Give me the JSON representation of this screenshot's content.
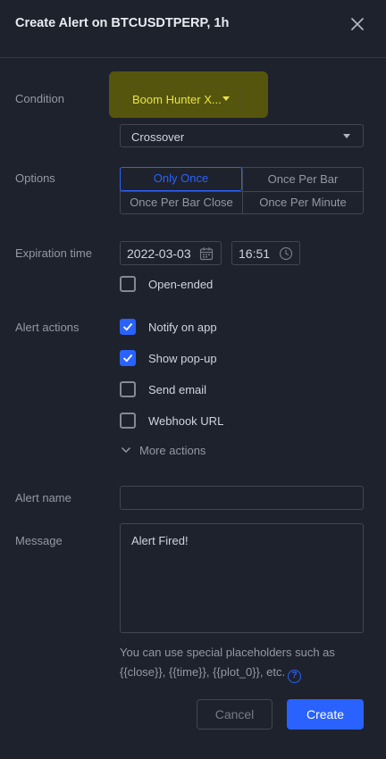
{
  "header": {
    "title": "Create Alert on BTCUSDTPERP, 1h",
    "close_icon": "close-icon"
  },
  "condition": {
    "label": "Condition",
    "indicator_value": "Boom Hunter X...",
    "crossing_value": "Crossover",
    "highlight_color": "#56550d"
  },
  "options": {
    "label": "Options",
    "items": [
      "Only Once",
      "Once Per Bar",
      "Once Per Bar Close",
      "Once Per Minute"
    ],
    "selected": "Only Once"
  },
  "expiration": {
    "label": "Expiration time",
    "date": "2022-03-03",
    "time": "16:51",
    "open_ended_label": "Open-ended",
    "open_ended_checked": false
  },
  "alert_actions": {
    "label": "Alert actions",
    "items": [
      {
        "label": "Notify on app",
        "checked": true
      },
      {
        "label": "Show pop-up",
        "checked": true
      },
      {
        "label": "Send email",
        "checked": false
      },
      {
        "label": "Webhook URL",
        "checked": false
      }
    ],
    "more_label": "More actions"
  },
  "alert_name": {
    "label": "Alert name",
    "value": ""
  },
  "message": {
    "label": "Message",
    "value": "Alert Fired!",
    "hint_line1": "You can use special placeholders such as",
    "hint_line2": "{{close}}, {{time}}, {{plot_0}}, etc."
  },
  "buttons": {
    "cancel": "Cancel",
    "create": "Create"
  },
  "colors": {
    "accent": "#2962ff",
    "background": "#1e222d",
    "condition_text": "#e8e547"
  }
}
